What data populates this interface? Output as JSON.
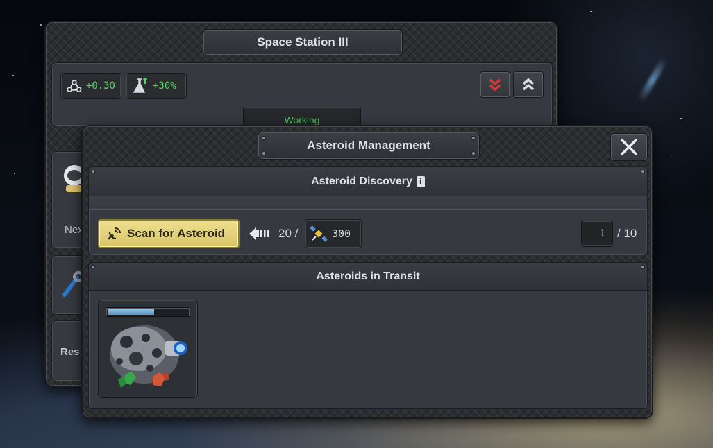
{
  "station": {
    "title": "Space Station III",
    "stat_resource": "+0.30",
    "stat_research": "+30%",
    "status": "Working",
    "side_next_label": "Nex",
    "side_res_label": "Res",
    "icons": [
      "resource-cycle-icon",
      "research-flask-icon",
      "collapse-chevron-icon",
      "expand-chevron-icon"
    ]
  },
  "asteroid_management": {
    "title": "Asteroid Management",
    "discovery": {
      "header": "Asteroid Discovery",
      "scan_button": "Scan for Asteroid",
      "cost_amount": "20 /",
      "cost_capacity": "300",
      "slot_current": "1",
      "slot_max": "/ 10"
    },
    "transit": {
      "header": "Asteroids in Transit",
      "items": [
        {
          "progress": 0.57,
          "resources": [
            "green-ore",
            "red-ore"
          ]
        }
      ]
    }
  },
  "colors": {
    "accent_green": "#58d26a",
    "scan_button": "#e6d47d",
    "danger_red": "#d23a3a"
  }
}
